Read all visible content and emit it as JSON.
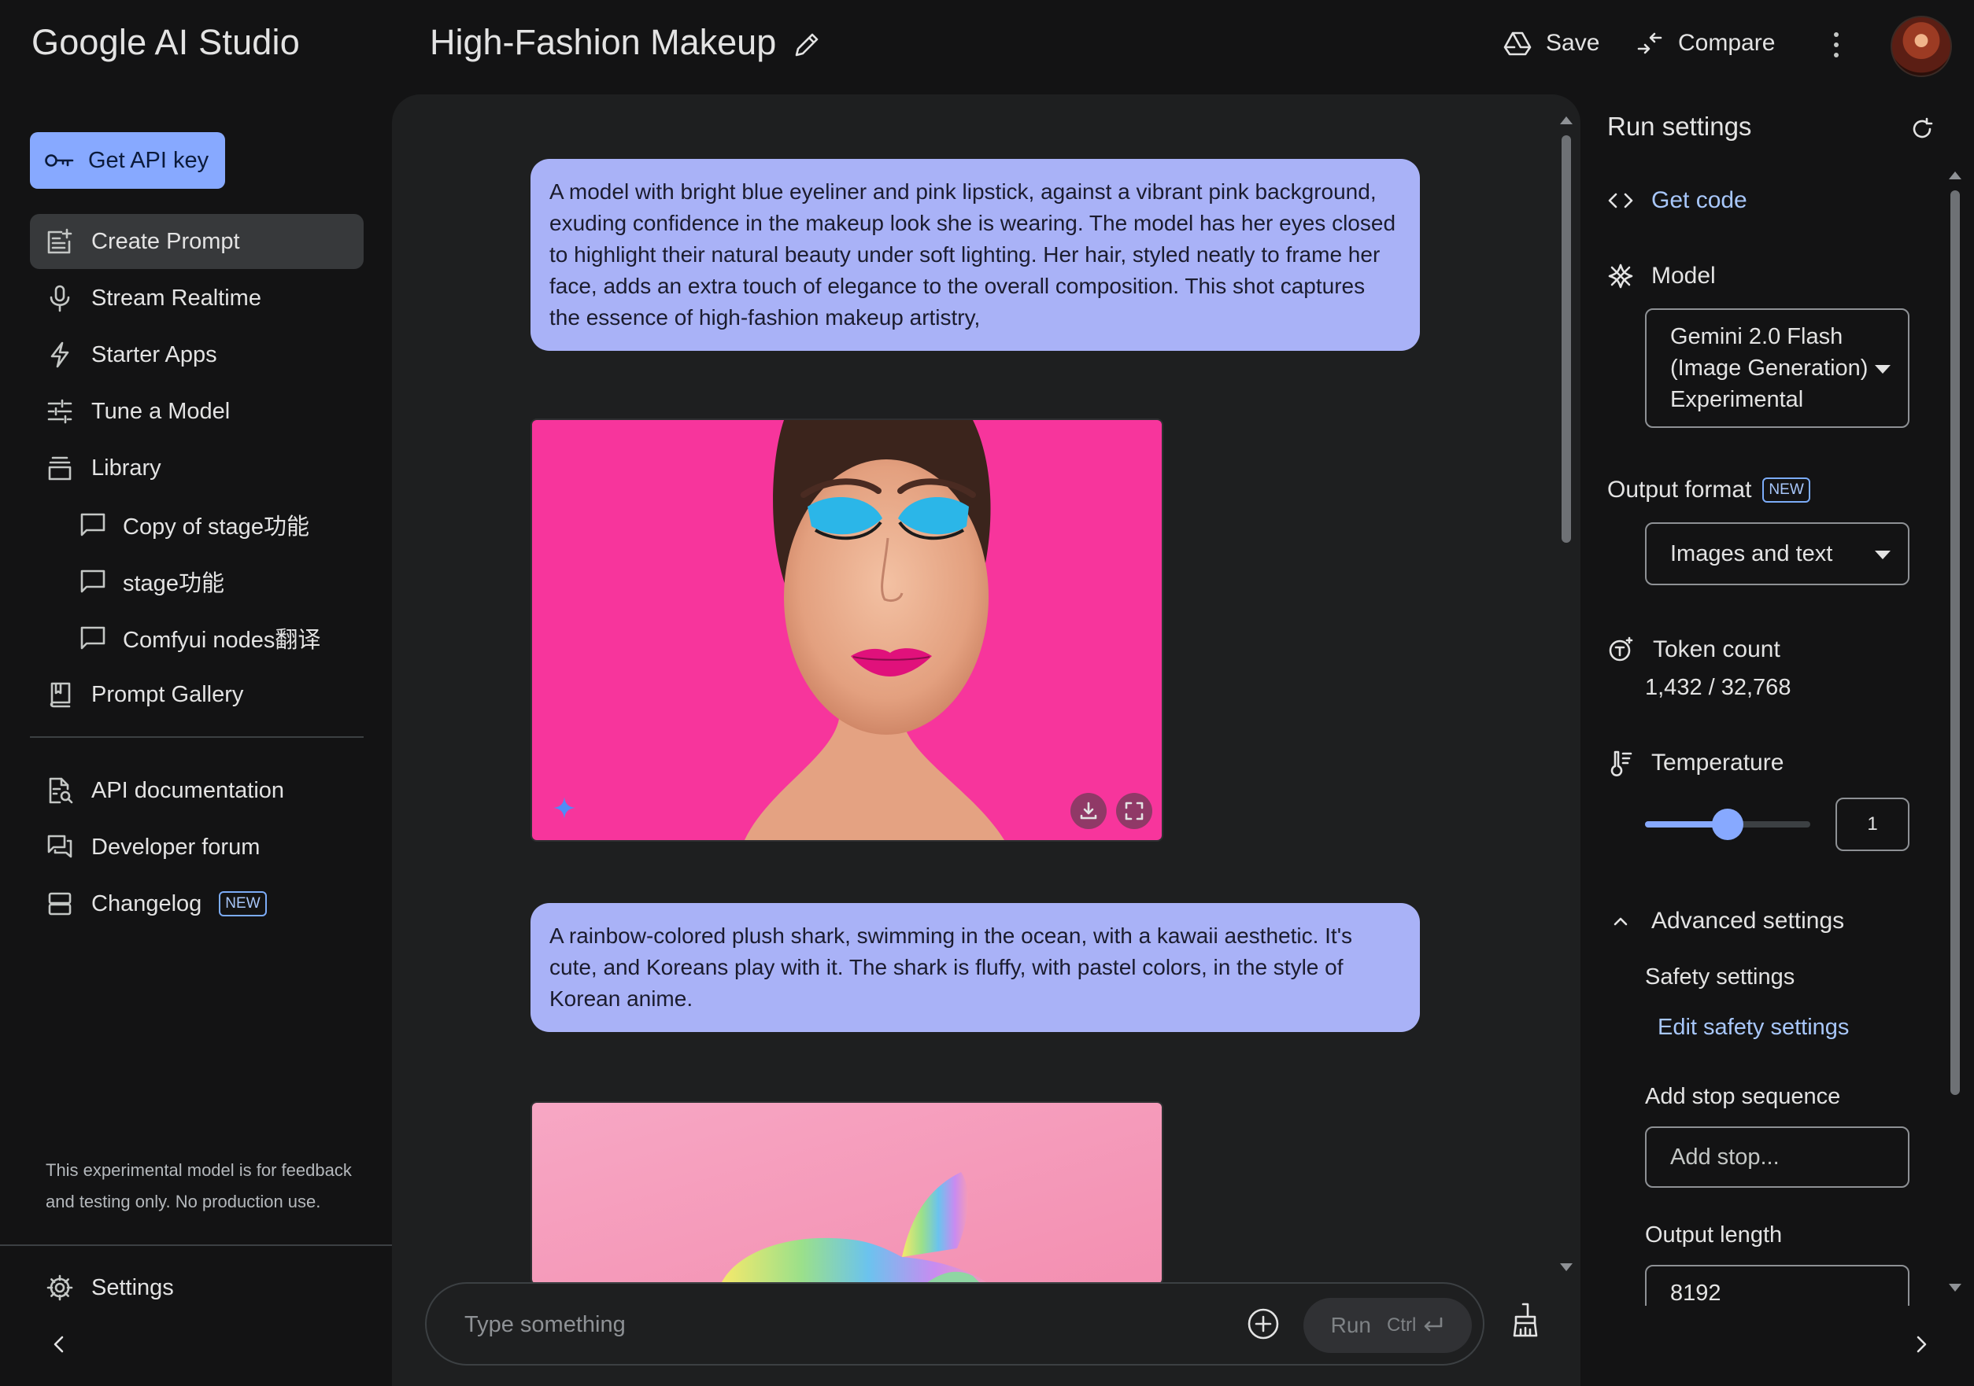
{
  "app": {
    "title": "Google AI Studio"
  },
  "header": {
    "prompt_title": "High-Fashion Makeup",
    "save_label": "Save",
    "compare_label": "Compare"
  },
  "sidebar": {
    "api_key_label": "Get API key",
    "items": [
      {
        "label": "Create Prompt",
        "icon": "create-prompt-icon",
        "active": true
      },
      {
        "label": "Stream Realtime",
        "icon": "mic-icon"
      },
      {
        "label": "Starter Apps",
        "icon": "bolt-icon"
      },
      {
        "label": "Tune a Model",
        "icon": "tune-icon"
      },
      {
        "label": "Library",
        "icon": "library-icon"
      }
    ],
    "library_items": [
      "Copy of stage功能",
      "stage功能",
      "Comfyui nodes翻译"
    ],
    "prompt_gallery_label": "Prompt Gallery",
    "links": [
      {
        "label": "API documentation",
        "icon": "api-doc-icon"
      },
      {
        "label": "Developer forum",
        "icon": "forum-icon"
      },
      {
        "label": "Changelog",
        "icon": "changelog-icon",
        "badge": "NEW"
      }
    ],
    "disclaimer": "This experimental model is for feedback and testing only. No production use.",
    "settings_label": "Settings"
  },
  "chat": {
    "messages": [
      {
        "role": "user",
        "text": "A model with bright blue eyeliner and pink lipstick, against a vibrant pink background, exuding confidence in the makeup look she is wearing. The model has her eyes closed to highlight their natural beauty under soft lighting. Her hair, styled neatly to frame her face, adds an extra touch of elegance to the overall composition. This shot captures the essence of high-fashion makeup artistry,"
      },
      {
        "role": "model",
        "type": "image",
        "subject": "makeup-portrait"
      },
      {
        "role": "user",
        "text": "A rainbow-colored plush shark, swimming in the ocean, with a kawaii aesthetic. It's cute, and Koreans play with it. The shark is fluffy, with pastel colors, in the style of Korean anime."
      },
      {
        "role": "model",
        "type": "image",
        "subject": "plush-shark"
      }
    ],
    "input_placeholder": "Type something",
    "run_label": "Run",
    "run_shortcut": "Ctrl"
  },
  "run_settings": {
    "title": "Run settings",
    "get_code_label": "Get code",
    "model_label": "Model",
    "model_value_lines": [
      "Gemini 2.0 Flash",
      "(Image Generation)",
      "Experimental"
    ],
    "output_format_label": "Output format",
    "output_format_badge": "NEW",
    "output_format_value": "Images and text",
    "token_count_label": "Token count",
    "token_count_value": "1,432 / 32,768",
    "temperature_label": "Temperature",
    "temperature_value": "1",
    "temperature_fraction": 0.5,
    "advanced_label": "Advanced settings",
    "safety_label": "Safety settings",
    "edit_safety_label": "Edit safety settings",
    "stop_sequence_label": "Add stop sequence",
    "stop_sequence_placeholder": "Add stop...",
    "output_length_label": "Output length",
    "output_length_value": "8192"
  },
  "colors": {
    "background": "#131314",
    "panel": "#1e1f20",
    "accent": "#87a9ff",
    "user_bubble": "#a9b2f7",
    "link": "#a8c7fa",
    "image_bg_pink": "#f7359c"
  }
}
